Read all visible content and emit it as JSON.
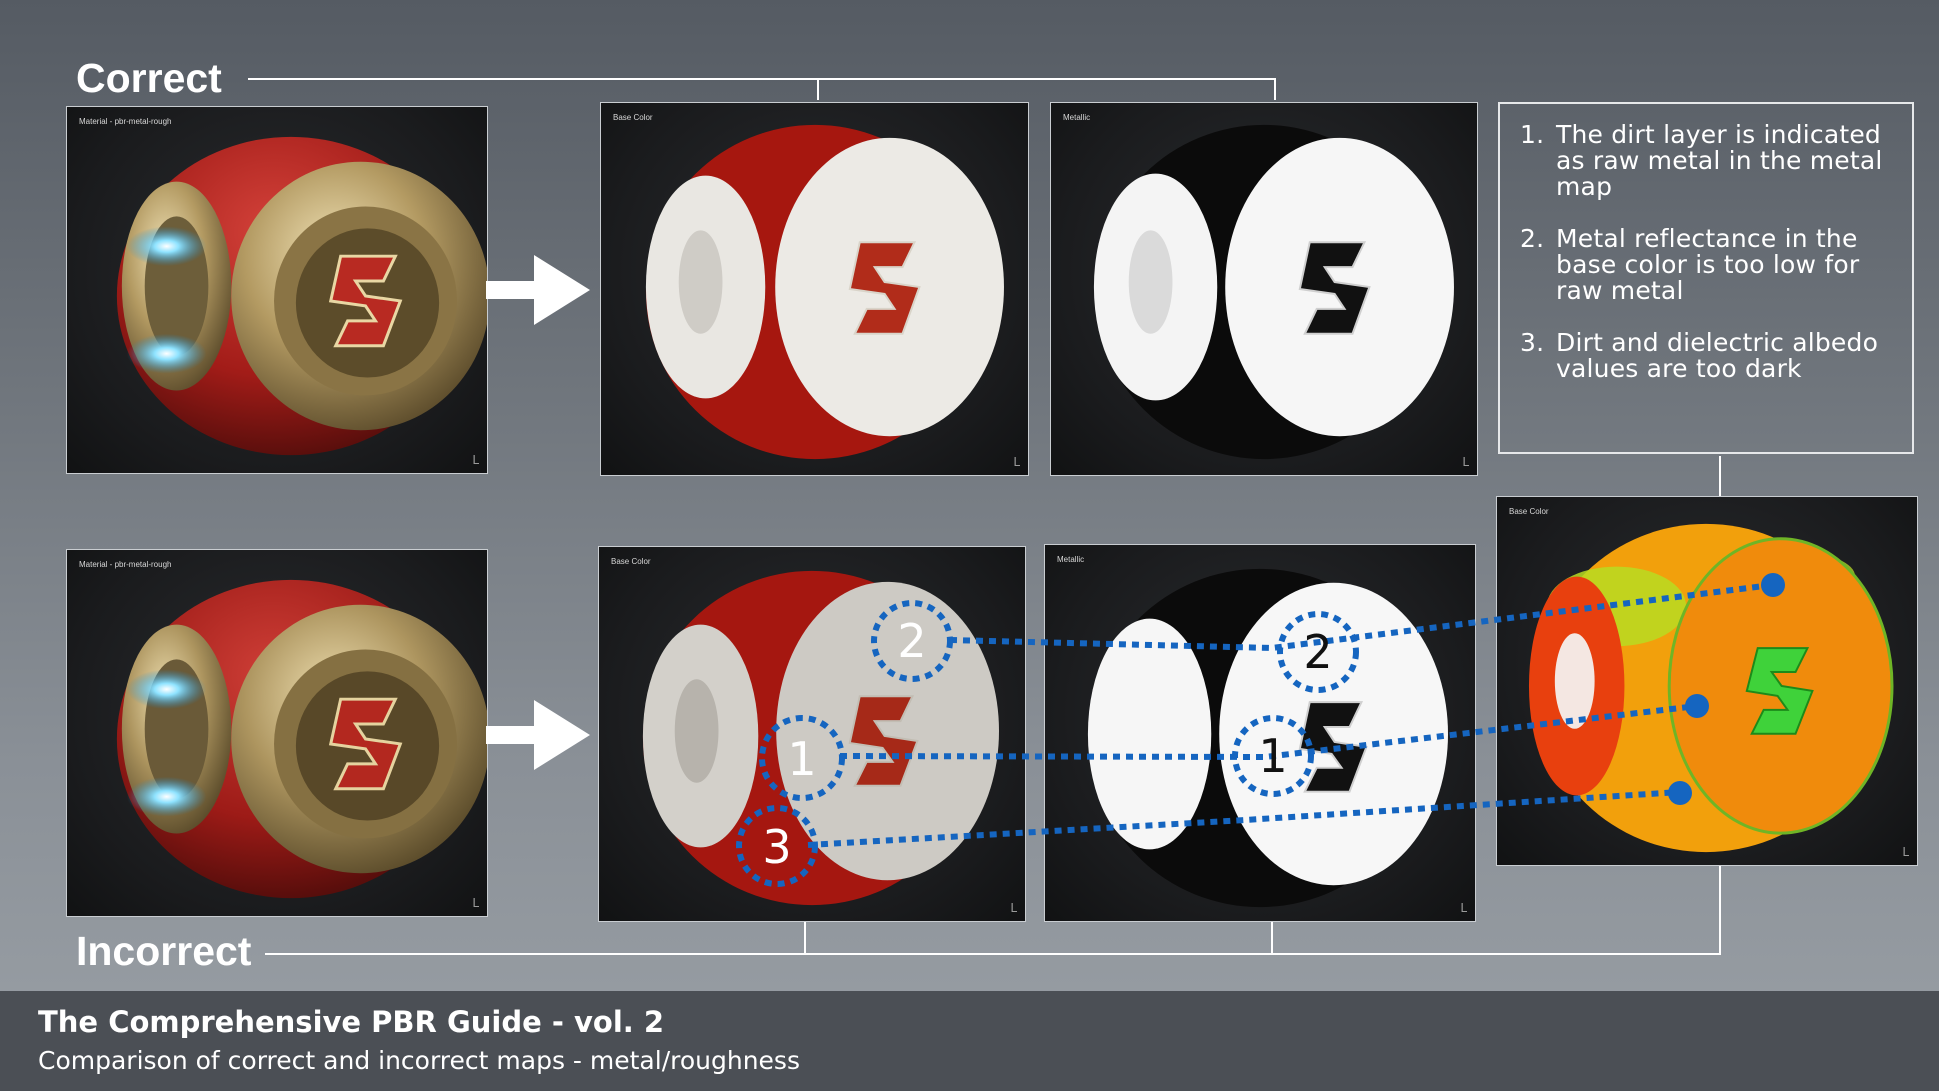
{
  "headings": {
    "correct": "Correct",
    "incorrect": "Incorrect"
  },
  "panels": {
    "correct_material": {
      "label": "Material - pbr-metal-rough"
    },
    "correct_basecolor": {
      "label": "Base Color"
    },
    "correct_metallic": {
      "label": "Metallic"
    },
    "incorrect_material": {
      "label": "Material - pbr-metal-rough"
    },
    "incorrect_basecolor": {
      "label": "Base Color"
    },
    "incorrect_metallic": {
      "label": "Metallic"
    },
    "validation": {
      "label": "Base Color"
    }
  },
  "corner_mark": "L",
  "notes": [
    {
      "num": "1.",
      "text": "The dirt layer is indicated as raw metal in the metal map"
    },
    {
      "num": "2.",
      "text": "Metal reflectance in the base color is too low for raw metal"
    },
    {
      "num": "3.",
      "text": "Dirt and dielectric albedo values are too dark"
    }
  ],
  "markers": [
    "2",
    "1",
    "3",
    "2",
    "1"
  ],
  "footer": {
    "title": "The Comprehensive PBR Guide - vol. 2",
    "subtitle": "Comparison of correct and incorrect maps - metal/roughness"
  },
  "colors": {
    "connector_line": "#ffffff",
    "marker_blue": "#1565c0",
    "painted_red": "#b01a17",
    "metal_gold": "#c9b27a",
    "validation_orange": "#f2a00c",
    "validation_green": "#3fd23a"
  }
}
